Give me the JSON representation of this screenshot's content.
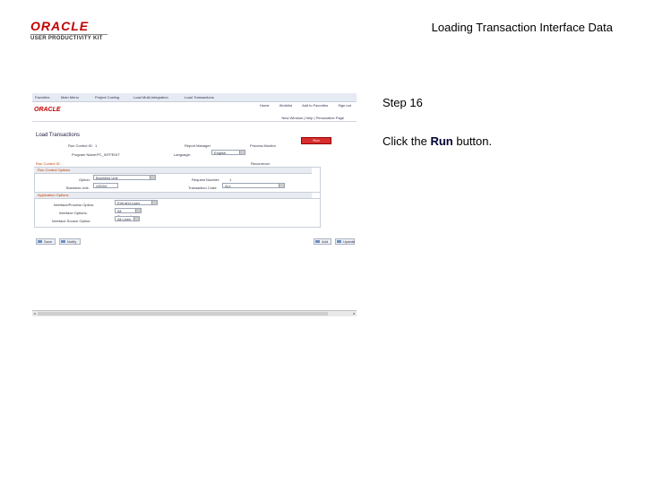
{
  "logo": {
    "brand": "ORACLE",
    "sub": "USER PRODUCTIVITY KIT"
  },
  "doc_title": "Loading Transaction Interface Data",
  "step": {
    "title": "Step 16",
    "instr_prefix": "Click the ",
    "instr_bold": "Run",
    "instr_suffix": " button."
  },
  "screenshot": {
    "topnav": [
      "Favorites",
      "Main Menu",
      "Project Costing",
      "Load Multi-Integration",
      "Load Transactions"
    ],
    "brand": "ORACLE",
    "right_links": [
      "Home",
      "Worklist",
      "Add to Favorites",
      "Sign out"
    ],
    "subbar_links": "New Window | Help | Personalize Page",
    "page_title": "Load Transactions",
    "run_control_label": "Run Control ID:",
    "run_control_value": "1",
    "report_manager": "Report Manager",
    "process_monitor": "Process Monitor",
    "run_button": "Run",
    "language_label": "Language:",
    "language_value": "English",
    "program_label": "Program Name:",
    "program_value": "PC_INTFEDIT",
    "recurrence_label": "Recurrence:",
    "section_run_control": "Run Control Options",
    "option_label": "Option:",
    "option_value": "Business Unit",
    "business_unit_label": "Business Unit:",
    "business_unit_value": "US004",
    "request_label": "Request Number:",
    "request_value": "1",
    "process_group_label": "Transaction Code:",
    "process_group_value": "ALL",
    "section_application": "Application Options",
    "interface_option_label": "Interface/Process Option:",
    "interface_option_value": "Edit and Load",
    "interface_status_label": "Interface Options:",
    "interface_status_value": "All Transactions",
    "interface_source_label": "Interface Source Option:",
    "interface_source_value": "All Lines",
    "save_button": "Save",
    "notify_button": "Notify",
    "add_button": "Add",
    "update_button": "Update"
  }
}
